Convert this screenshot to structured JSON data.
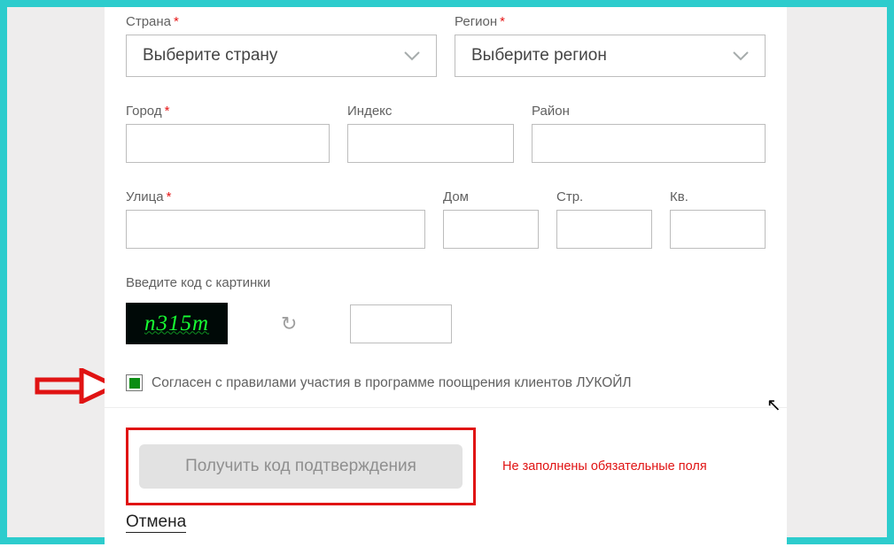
{
  "fields": {
    "country": {
      "label": "Страна",
      "placeholder": "Выберите страну",
      "required": true
    },
    "region": {
      "label": "Регион",
      "placeholder": "Выберите регион",
      "required": true
    },
    "city": {
      "label": "Город",
      "required": true
    },
    "index": {
      "label": "Индекс"
    },
    "district": {
      "label": "Район"
    },
    "street": {
      "label": "Улица",
      "required": true
    },
    "house": {
      "label": "Дом"
    },
    "building": {
      "label": "Стр."
    },
    "apt": {
      "label": "Кв."
    }
  },
  "captcha": {
    "label": "Введите код с картинки",
    "code": "n315m"
  },
  "agree": {
    "checked": true,
    "label": "Согласен с правилами участия в программе поощрения клиентов ЛУКОЙЛ"
  },
  "actions": {
    "submit": "Получить код подтверждения",
    "cancel": "Отмена"
  },
  "error": "Не заполнены обязательные поля"
}
